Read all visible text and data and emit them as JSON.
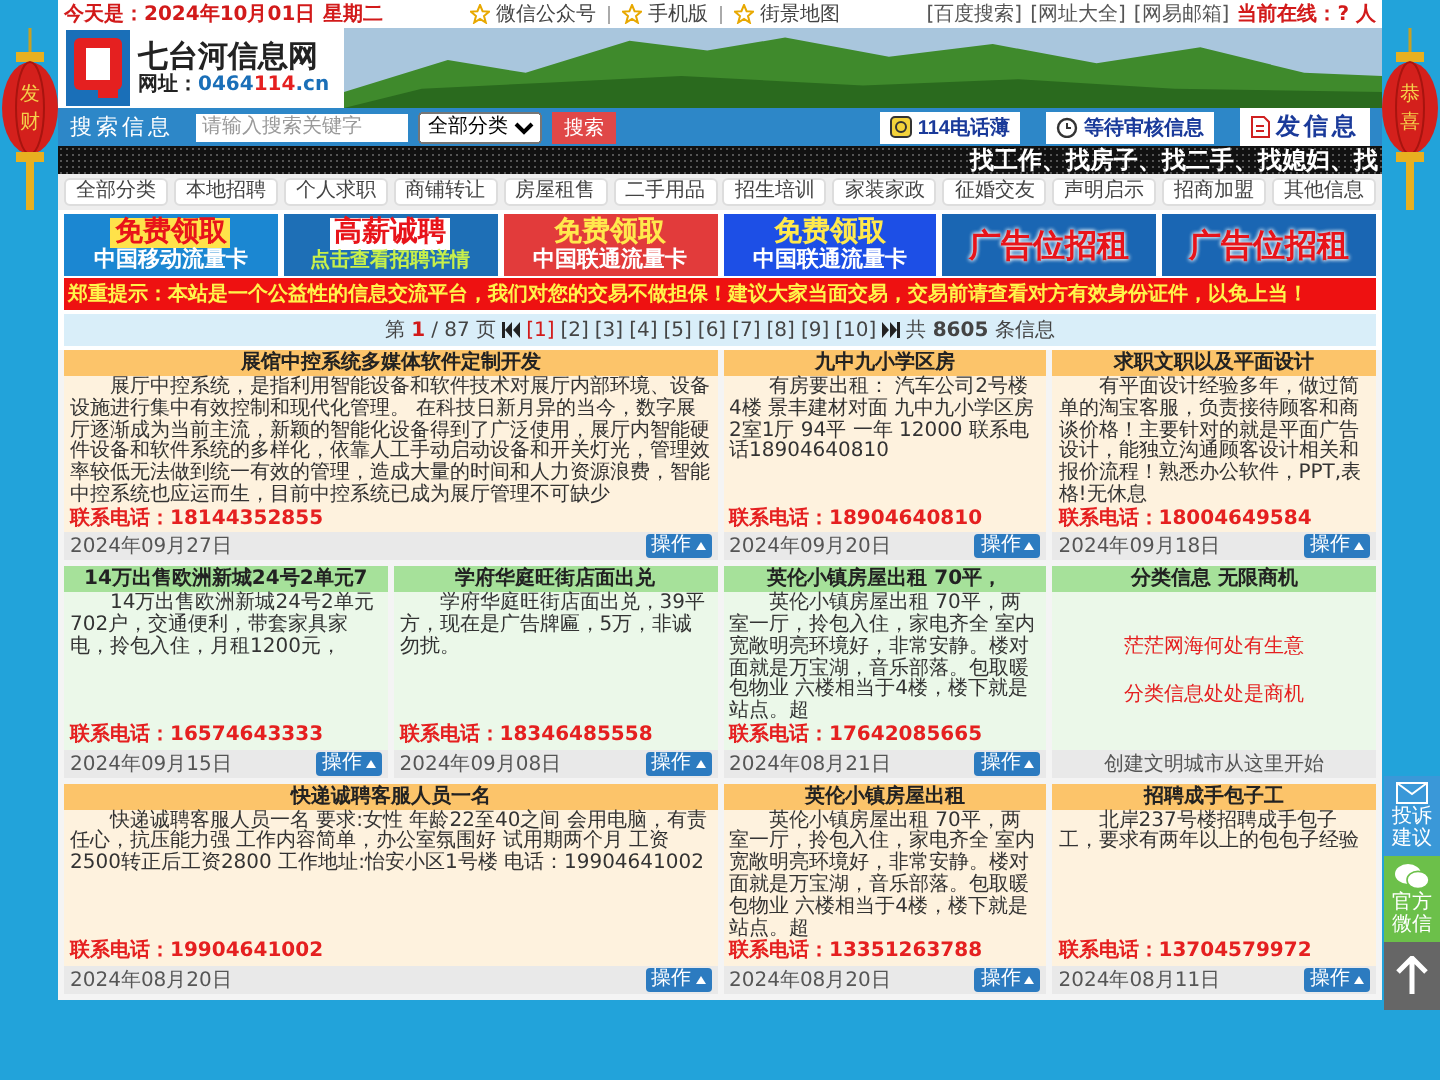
{
  "top_bar": {
    "date": "今天是：2024年10月01日",
    "weekday": "星期二",
    "links": [
      {
        "label": "微信公众号"
      },
      {
        "label": "手机版"
      },
      {
        "label": "街景地图"
      }
    ],
    "quick_links": [
      "[百度搜索]",
      "[网址大全]",
      "[网易邮箱]"
    ],
    "online": "当前在线：? 人"
  },
  "lanterns": [
    {
      "chars": [
        "发",
        "财"
      ]
    },
    {
      "chars": [
        "恭",
        "喜"
      ]
    }
  ],
  "logo": {
    "name": "七台河信息网",
    "url_label": "网址：",
    "url": [
      {
        "text": "0464",
        "kind": "plain"
      },
      {
        "text": "114",
        "kind": "accent"
      },
      {
        "text": ".cn",
        "kind": "plain"
      }
    ]
  },
  "search": {
    "title": "搜索信息",
    "placeholder": "请输入搜索关键字",
    "category": "全部分类",
    "button": "搜索",
    "actions": [
      {
        "label": "114电话薄",
        "kind": "phonebook"
      },
      {
        "label": "等待审核信息",
        "kind": "pending"
      },
      {
        "label": "发信息",
        "kind": "post"
      }
    ]
  },
  "ticker": "找工作、找房子、找二手、找媳妇、找",
  "nav": [
    "全部分类",
    "本地招聘",
    "个人求职",
    "商铺转让",
    "房屋租售",
    "二手用品",
    "招生培训",
    "家装家政",
    "征婚交友",
    "声明启示",
    "招商加盟",
    "其他信息"
  ],
  "ads": [
    {
      "line1": "免费领取",
      "line2": "中国移动流量卡",
      "kind": "mobile",
      "color": "#1b87d2"
    },
    {
      "line1": "高薪诚聘",
      "line2": "点击查看招聘详情",
      "kind": "recruit",
      "color": "#1e6fb6"
    },
    {
      "line1": "免费领取",
      "line2": "中国联通流量卡",
      "kind": "unicom",
      "color": "#e23b3b"
    },
    {
      "line1": "免费领取",
      "line2": "中国联通流量卡",
      "kind": "unicom",
      "color": "#1d4fe6"
    },
    {
      "line1": "广告位招租",
      "kind": "rent",
      "color": "#1a66b3"
    },
    {
      "line1": "广告位招租",
      "kind": "rent",
      "color": "#1a66b3"
    }
  ],
  "notice": "郑重提示：本站是一个公益性的信息交流平台，我们对您的交易不做担保！建议大家当面交易，交易前请查看对方有效身份证件，以免上当！",
  "pagination": {
    "prefix": "第",
    "current": "1",
    "suffix": "/ 87 页",
    "pages": [
      {
        "label": "[1]",
        "selected": true
      },
      {
        "label": "[2]",
        "selected": false
      },
      {
        "label": "[3]",
        "selected": false
      },
      {
        "label": "[4]",
        "selected": false
      },
      {
        "label": "[5]",
        "selected": false
      },
      {
        "label": "[6]",
        "selected": false
      },
      {
        "label": "[7]",
        "selected": false
      },
      {
        "label": "[8]",
        "selected": false
      },
      {
        "label": "[9]",
        "selected": false
      },
      {
        "label": "[10]",
        "selected": false
      }
    ],
    "total": "共 **8605** 条信息"
  },
  "listings": [
    {
      "kind": "post",
      "wide": true,
      "color": "#fcc46a",
      "title": "展馆中控系统多媒体软件定制开发",
      "body": "展厅中控系统，是指利用智能设备和软件技术对展厅内部环境、设备设施进行集中有效控制和现代化管理。 在科技日新月异的当今，数字展厅逐渐成为当前主流，新颖的智能化设备得到了广泛使用，展厅内智能硬件设备和软件系统的多样化，依靠人工手动启动设备和开关灯光，管理效率较低无法做到统一有效的管理，造成大量的时间和人力资源浪费，智能中控系统也应运而生，目前中控系统已成为展厅管理不可缺少",
      "phone": "联系电话：18144352855",
      "date": "2024年09月27日",
      "action": "操作"
    },
    {
      "kind": "post",
      "wide": false,
      "color": "#fcc46a",
      "title": "九中九小学区房",
      "body": "有房要出租： 汽车公司2号楼 4楼 景丰建材对面 九中九小学区房 2室1厅 94平 一年 12000 联系电话18904640810",
      "phone": "联系电话：18904640810",
      "date": "2024年09月20日",
      "action": "操作"
    },
    {
      "kind": "post",
      "wide": false,
      "color": "#fcc46a",
      "title": "求职文职以及平面设计",
      "body": "有平面设计经验多年，做过简单的淘宝客服，负责接待顾客和商谈价格！主要针对的就是平面广告设计，能独立沟通顾客设计相关和报价流程！熟悉办公软件，PPT,表格!无休息",
      "phone": "联系电话：18004649584",
      "date": "2024年09月18日",
      "action": "操作"
    },
    {
      "kind": "post",
      "wide": false,
      "color": "#a6e19a",
      "title": "14万出售欧洲新城24号2单元7",
      "body": "14万出售欧洲新城24号2单元702户，交通便利，带套家具家电，拎包入住，月租1200元，",
      "phone": "联系电话：16574643333",
      "date": "2024年09月15日",
      "action": "操作"
    },
    {
      "kind": "post",
      "wide": false,
      "color": "#a6e19a",
      "title": "学府华庭旺街店面出兑",
      "body": "学府华庭旺街店面出兑，39平方，现在是广告牌匾，5万，非诚勿扰。",
      "phone": "联系电话：18346485558",
      "date": "2024年09月08日",
      "action": "操作"
    },
    {
      "kind": "post",
      "wide": false,
      "color": "#a6e19a",
      "title": "英伦小镇房屋出租 70平，",
      "body": "英伦小镇房屋出租 70平，两室一厅，拎包入住，家电齐全 室内宽敞明亮环境好，非常安静。楼对面就是万宝湖，音乐部落。包取暖包物业 六楼相当于4楼，楼下就是站点。超",
      "phone": "联系电话：17642085665",
      "date": "2024年08月21日",
      "action": "操作"
    },
    {
      "kind": "promo",
      "wide": false,
      "color": "#a6e19a",
      "title": "分类信息 无限商机",
      "lines": [
        "茫茫网海何处有生意",
        "分类信息处处是商机"
      ],
      "footer": "创建文明城市从这里开始"
    },
    {
      "kind": "post",
      "wide": true,
      "color": "#fcc46a",
      "title": "快递诚聘客服人员一名",
      "body": "快递诚聘客服人员一名 要求:女性 年龄22至40之间 会用电脑，有责任心，抗压能力强 工作内容简单，办公室氛围好 试用期两个月 工资2500转正后工资2800 工作地址:怡安小区1号楼 电话：19904641002",
      "phone": "联系电话：19904641002",
      "date": "2024年08月20日",
      "action": "操作"
    },
    {
      "kind": "post",
      "wide": false,
      "color": "#fcc46a",
      "title": "英伦小镇房屋出租",
      "body": "英伦小镇房屋出租 70平，两室一厅，拎包入住，家电齐全 室内宽敞明亮环境好，非常安静。楼对面就是万宝湖，音乐部落。包取暖包物业 六楼相当于4楼，楼下就是站点。超",
      "phone": "联系电话：13351263788",
      "date": "2024年08月20日",
      "action": "操作"
    },
    {
      "kind": "post",
      "wide": false,
      "color": "#fcc46a",
      "title": "招聘成手包子工",
      "body": "北岸237号楼招聘成手包子工，要求有两年以上的包包子经验",
      "phone": "联系电话：13704579972",
      "date": "2024年08月11日",
      "action": "操作"
    }
  ],
  "float_buttons": [
    {
      "kind": "complaint",
      "label": "投诉建议"
    },
    {
      "kind": "wechat",
      "label": "官方微信"
    },
    {
      "kind": "top"
    }
  ]
}
